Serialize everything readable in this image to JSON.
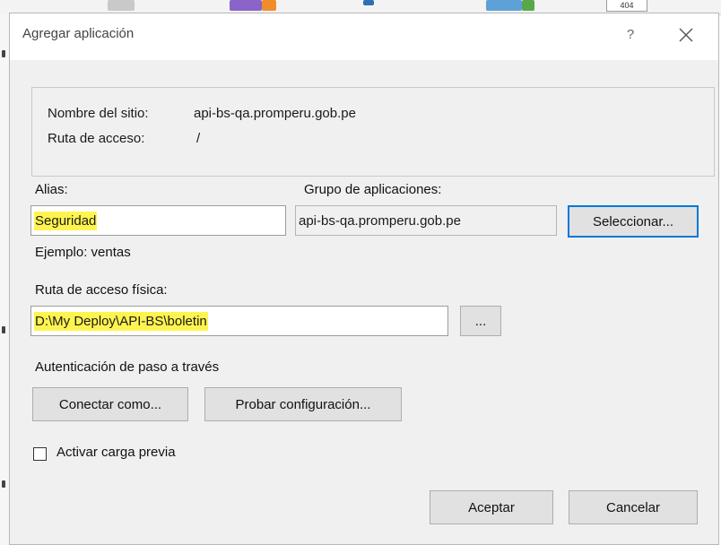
{
  "background": {
    "tab_number": "404"
  },
  "dialog": {
    "title": "Agregar aplicación",
    "help_label": "?",
    "close_icon": "close-icon"
  },
  "site_info": {
    "site_name_label": "Nombre del sitio:",
    "site_name_value": "api-bs-qa.promperu.gob.pe",
    "path_label": "Ruta de acceso:",
    "path_value": "/"
  },
  "alias": {
    "label": "Alias:",
    "value": "Seguridad",
    "example": "Ejemplo: ventas"
  },
  "app_pool": {
    "label": "Grupo de aplicaciones:",
    "value": "api-bs-qa.promperu.gob.pe",
    "select_label": "Seleccionar..."
  },
  "physical_path": {
    "label": "Ruta de acceso física:",
    "value": "D:\\My Deploy\\API-BS\\boletin",
    "browse_label": "..."
  },
  "auth": {
    "label": "Autenticación de paso a través",
    "connect_label": "Conectar como...",
    "test_label": "Probar configuración..."
  },
  "preload": {
    "label": "Activar carga previa",
    "checked": false
  },
  "footer": {
    "ok_label": "Aceptar",
    "cancel_label": "Cancelar"
  },
  "colors": {
    "highlight": "#fff44f",
    "accent": "#0078d7"
  }
}
